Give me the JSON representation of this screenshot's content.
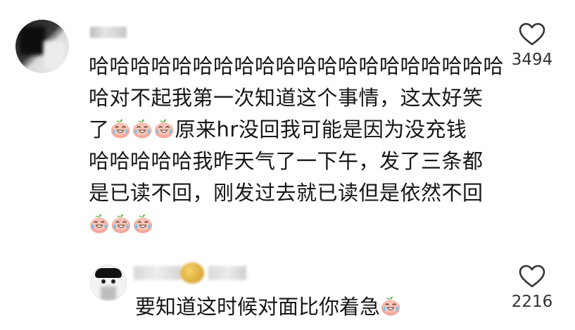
{
  "comment": {
    "lines": [
      {
        "text": "哈哈哈哈哈哈哈哈哈哈哈哈哈哈哈哈哈哈哈哈",
        "emoji_before": 0,
        "emoji_after": 0
      },
      {
        "text": "哈对不起我第一次知道这个事情，这太好笑",
        "emoji_before": 0,
        "emoji_after": 0
      },
      {
        "prefix": "了",
        "emoji_count": 3,
        "text": "原来hr没回我可能是因为没充钱"
      },
      {
        "text": "哈哈哈哈哈我昨天气了一下午，发了三条都"
      },
      {
        "text": "是已读不回，刚发过去就已读但是依然不回"
      }
    ],
    "line1": "哈哈哈哈哈哈哈哈哈哈哈哈哈哈哈哈哈哈哈哈",
    "line2": "哈对不起我第一次知道这个事情，这太好笑",
    "line3_prefix": "了",
    "line3_rest": "原来hr没回我可能是因为没充钱",
    "line4": "哈哈哈哈哈我昨天气了一下午，发了三条都",
    "line5": "是已读不回，刚发过去就已读但是依然不回",
    "like_count": "3494",
    "emoji": "crying-laughing-peach-emoji"
  },
  "reply": {
    "text": "要知道这时候对面比你着急",
    "like_count": "2216"
  },
  "icons": {
    "like": "heart-outline-icon"
  },
  "colors": {
    "text": "#161616",
    "count": "#333333",
    "heart_stroke": "#333333"
  }
}
